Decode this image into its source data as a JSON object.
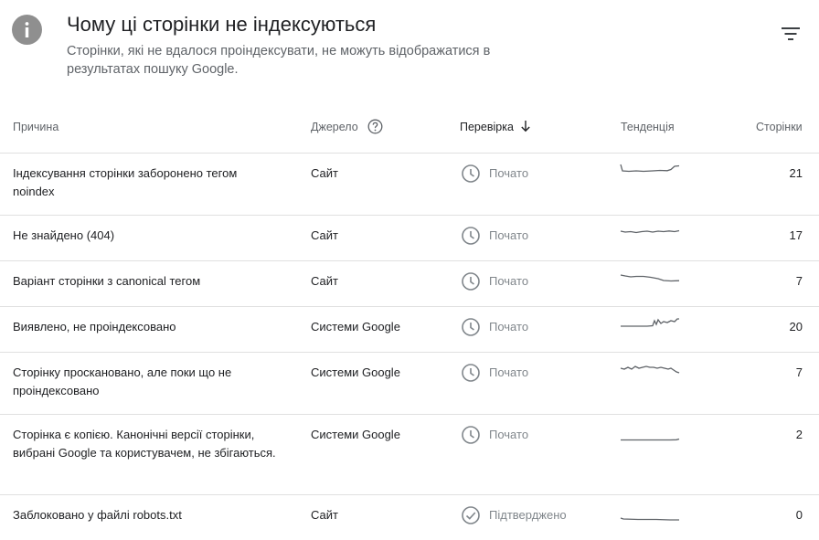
{
  "header": {
    "title": "Чому ці сторінки не індексуються",
    "subtitle": "Сторінки, які не вдалося проіндексувати, не можуть відображатися в результатах пошуку Google.",
    "info_icon": "info-icon",
    "filter_icon": "filter-icon"
  },
  "table": {
    "columns": {
      "reason": "Причина",
      "source": "Джерело",
      "validation": "Перевірка",
      "trend": "Тенденція",
      "pages": "Сторінки"
    },
    "rows": [
      {
        "reason": "Індексування сторінки заборонено тегом noindex",
        "source": "Сайт",
        "status": "Почато",
        "status_icon": "clock-icon",
        "pages": "21"
      },
      {
        "reason": "Не знайдено (404)",
        "source": "Сайт",
        "status": "Почато",
        "status_icon": "clock-icon",
        "pages": "17"
      },
      {
        "reason": "Варіант сторінки з canonical тегом",
        "source": "Сайт",
        "status": "Почато",
        "status_icon": "clock-icon",
        "pages": "7"
      },
      {
        "reason": "Виявлено, не проіндексовано",
        "source": "Системи Google",
        "status": "Почато",
        "status_icon": "clock-icon",
        "pages": "20"
      },
      {
        "reason": "Сторінку проскановано, але поки що не проіндексовано",
        "source": "Системи Google",
        "status": "Почато",
        "status_icon": "clock-icon",
        "pages": "7"
      },
      {
        "reason": "Сторінка є копією. Канонічні версії сторінки, вибрані Google та користувачем, не збігаються.",
        "source": "Системи Google",
        "status": "Почато",
        "status_icon": "clock-icon",
        "pages": "2"
      },
      {
        "reason": "Заблоковано у файлі robots.txt",
        "source": "Сайт",
        "status": "Підтверджено",
        "status_icon": "check-circle-icon",
        "pages": "0"
      }
    ]
  },
  "colors": {
    "title": "#202124",
    "secondary_text": "#5f6368",
    "status_text": "#80868b",
    "info_icon_bg": "#8f8f8f",
    "divider": "#e0e0e0",
    "sparkline": "#5f6368"
  }
}
